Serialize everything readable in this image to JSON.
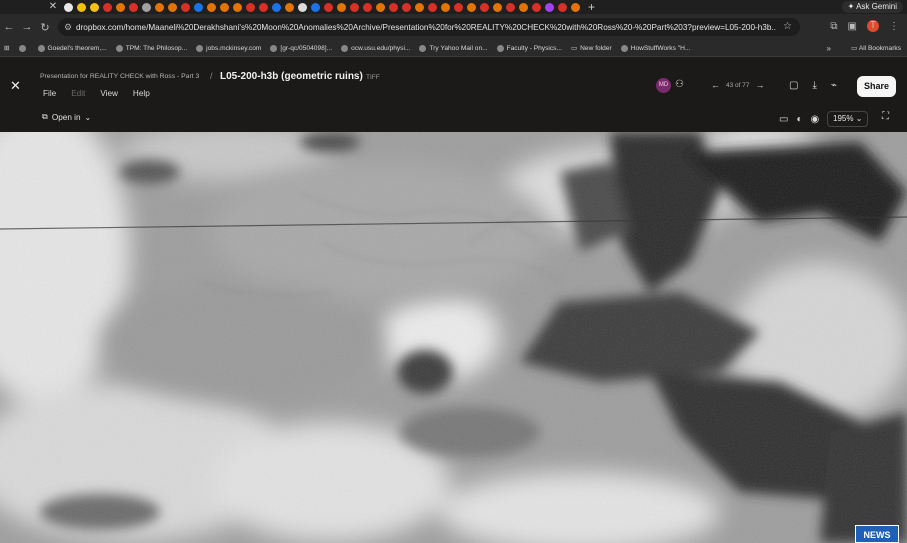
{
  "browser": {
    "gemini_label": "Ask Gemini",
    "url": "dropbox.com/home/Maaneli%20Derakhshani's%20Moon%20Anomalies%20Archive/Presentation%20for%20REALITY%20CHECK%20with%20Ross%20-%20Part%203?preview=L05-200-h3b...",
    "profile_initial": "T",
    "bookmarks": [
      {
        "label": "Goedel's theorem,..."
      },
      {
        "label": "TPM: The Philosop..."
      },
      {
        "label": "jobs.mckinsey.com"
      },
      {
        "label": "[gr-qc/0504098]..."
      },
      {
        "label": "ocw.usu.edu/physi..."
      },
      {
        "label": "Try Yahoo Mail on..."
      },
      {
        "label": "Faculty - Physics..."
      },
      {
        "label": "New folder"
      },
      {
        "label": "HowStuffWorks \"H..."
      }
    ],
    "all_bookmarks_label": "All Bookmarks",
    "accent_color": "#8ab4f8"
  },
  "viewer": {
    "breadcrumb": "Presentation for REALITY CHECK with Ross - Part 3",
    "filename": "L05-200-h3b (geometric ruins)",
    "filetype": "TIFF",
    "menu": {
      "file": "File",
      "edit": "Edit",
      "view": "View",
      "help": "Help"
    },
    "avatar_initials": "MD",
    "page_counter": "43 of 77",
    "share_label": "Share",
    "open_in_label": "Open in",
    "zoom_level": "195%"
  },
  "overlay": {
    "news_badge": "NEWS"
  }
}
